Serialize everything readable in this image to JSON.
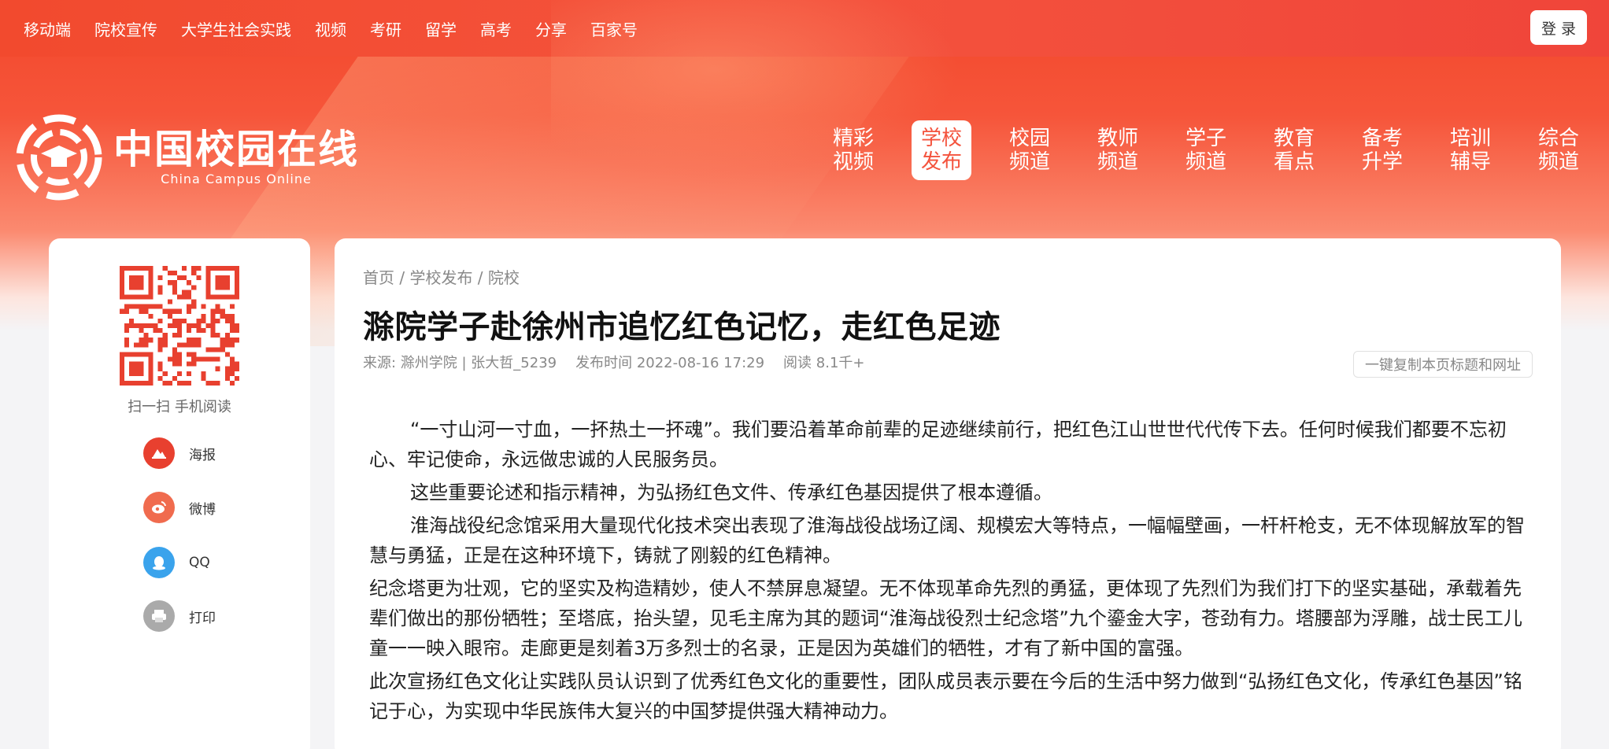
{
  "topnav": [
    "移动端",
    "院校宣传",
    "大学生社会实践",
    "视频",
    "考研",
    "留学",
    "高考",
    "分享",
    "百家号"
  ],
  "login_label": "登 录",
  "logo": {
    "cn": "中国校园在线",
    "en": "China Campus Online"
  },
  "mainnav": [
    {
      "label": "精彩视频"
    },
    {
      "label": "学校发布",
      "active": true
    },
    {
      "label": "校园频道"
    },
    {
      "label": "教师频道"
    },
    {
      "label": "学子频道"
    },
    {
      "label": "教育看点"
    },
    {
      "label": "备考升学"
    },
    {
      "label": "培训辅导"
    },
    {
      "label": "综合频道"
    }
  ],
  "sidebar": {
    "scan_label": "扫一扫 手机阅读",
    "share": [
      {
        "label": "海报",
        "icon": "poster-icon",
        "color": "#e8402f"
      },
      {
        "label": "微博",
        "icon": "weibo-icon",
        "color": "#f06b4e"
      },
      {
        "label": "QQ",
        "icon": "qq-icon",
        "color": "#3aa3ec"
      },
      {
        "label": "打印",
        "icon": "print-icon",
        "color": "#aaaaaa"
      }
    ]
  },
  "article": {
    "breadcrumb": "首页 / 学校发布 / 院校",
    "title": "滁院学子赴徐州市追忆红色记忆，走红色足迹",
    "source": "来源:   滁州学院 | 张大哲_5239",
    "published": "发布时间 2022-08-16 17:29",
    "reads": "阅读 8.1千+",
    "copy_label": "一键复制本页标题和网址",
    "paragraphs": [
      {
        "text": "“一寸山河一寸血，一抔热土一抔魂”。我们要沿着革命前辈的足迹继续前行，把红色江山世世代代传下去。任何时候我们都要不忘初心、牢记使命，永远做忠诚的人民服务员。",
        "indent": true
      },
      {
        "text": "这些重要论述和指示精神，为弘扬红色文件、传承红色基因提供了根本遵循。",
        "indent": true
      },
      {
        "text": "淮海战役纪念馆采用大量现代化技术突出表现了淮海战役战场辽阔、规模宏大等特点，一幅幅壁画，一杆杆枪支，无不体现解放军的智慧与勇猛，正是在这种环境下，铸就了刚毅的红色精神。",
        "indent": true
      },
      {
        "text": "纪念塔更为壮观，它的坚实及构造精妙，使人不禁屏息凝望。无不体现革命先烈的勇猛，更体现了先烈们为我们打下的坚实基础，承载着先辈们做出的那份牺牲；至塔底，抬头望，见毛主席为其的题词“淮海战役烈士纪念塔”九个鎏金大字，苍劲有力。塔腰部为浮雕，战士民工儿童一一映入眼帘。走廊更是刻着3万多烈士的名录，正是因为英雄们的牺牲，才有了新中国的富强。",
        "indent": false
      },
      {
        "text": "此次宣扬红色文化让实践队员认识到了优秀红色文化的重要性，团队成员表示要在今后的生活中努力做到“弘扬红色文化，传承红色基因”铭记于心，为实现中华民族伟大复兴的中国梦提供强大精神动力。",
        "indent": false
      }
    ]
  }
}
